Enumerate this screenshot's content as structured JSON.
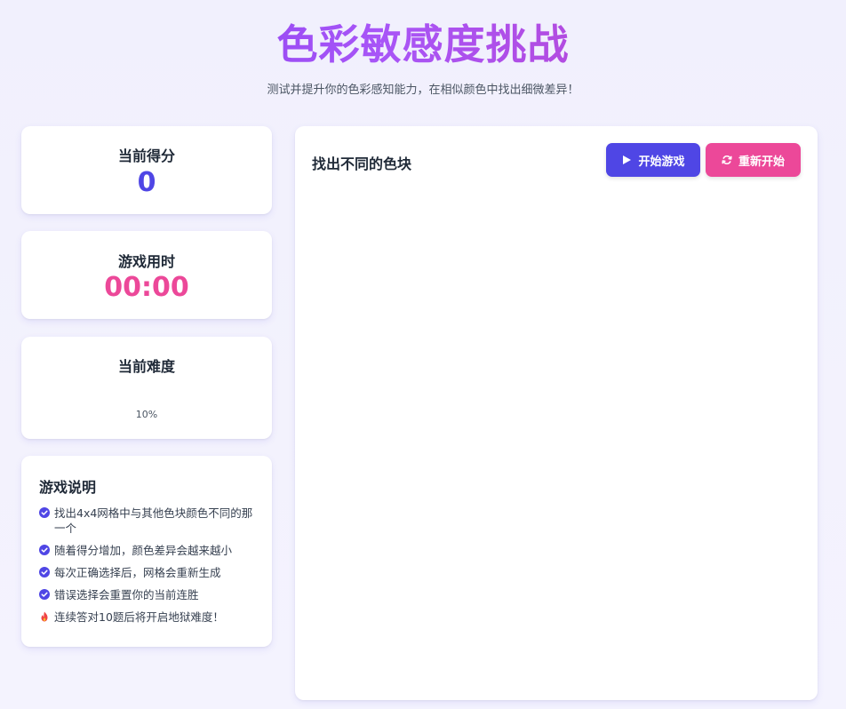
{
  "header": {
    "title": "色彩敏感度挑战",
    "subtitle": "测试并提升你的色彩感知能力，在相似颜色中找出细微差异！"
  },
  "stats": {
    "score": {
      "label": "当前得分",
      "value": "0"
    },
    "time": {
      "label": "游戏用时",
      "value": "00:00"
    },
    "difficulty": {
      "label": "当前难度",
      "percent": "10%"
    }
  },
  "rules": {
    "title": "游戏说明",
    "items": [
      {
        "text": "找出4x4网格中与其他色块颜色不同的那一个",
        "icon": "check-circle-icon"
      },
      {
        "text": "随着得分增加，颜色差异会越来越小",
        "icon": "check-circle-icon"
      },
      {
        "text": "每次正确选择后，网格会重新生成",
        "icon": "check-circle-icon"
      },
      {
        "text": "错误选择会重置你的当前连胜",
        "icon": "check-circle-icon"
      },
      {
        "text": "连续答对10题后将开启地狱难度！",
        "icon": "fire-icon"
      }
    ]
  },
  "board": {
    "title": "找出不同的色块",
    "start_label": "开始游戏",
    "restart_label": "重新开始"
  },
  "colors": {
    "primary": "#4f46e5",
    "accent": "#ec4899",
    "title_gradient_start": "#7c3aed",
    "title_gradient_end": "#c13fc0",
    "fire": "#ef4444"
  }
}
